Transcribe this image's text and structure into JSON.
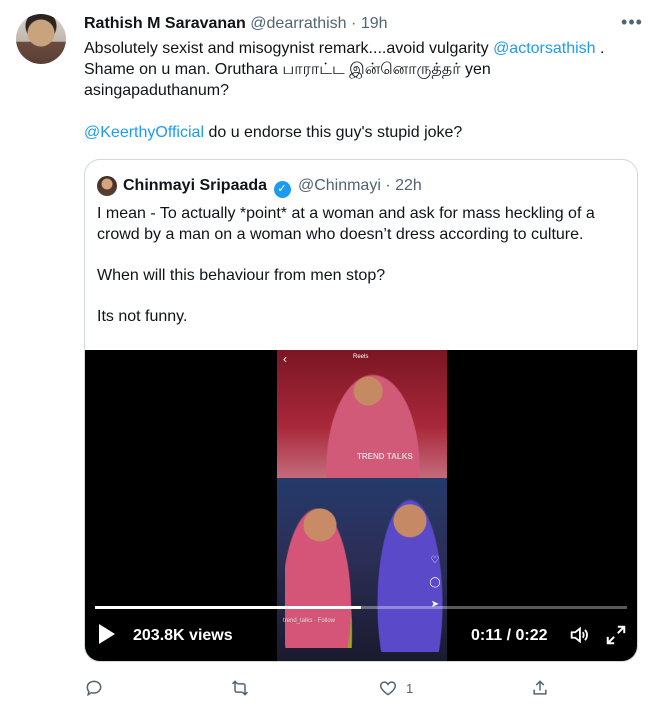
{
  "tweet": {
    "author_name": "Rathish M Saravanan",
    "author_handle": "@dearrathish",
    "separator": "·",
    "time": "19h",
    "text_line1_before": "Absolutely sexist and misogynist remark....avoid vulgarity ",
    "mention1": "@actorsathish",
    "text_line1_after": " .",
    "text_line2": "Shame on u man. Oruthara பாராட்ட இன்னொருத்தர் yen",
    "text_line3": "asingapaduthanum?",
    "mention2": "@KeerthyOfficial",
    "text_line4_after": " do u endorse this guy's stupid joke?"
  },
  "quote": {
    "author_name": "Chinmayi Sripaada",
    "author_handle": "@Chinmayi",
    "separator": "·",
    "time": "22h",
    "paragraph1": "I mean - To actually *point* at a woman and ask for mass heckling of a crowd by a man on a woman who doesn’t dress according to culture.",
    "paragraph2": "When will this behaviour from men stop?",
    "paragraph3": "Its not funny."
  },
  "video": {
    "views": "203.8K views",
    "current_time": "0:11",
    "time_separator": " / ",
    "duration": "0:22",
    "progress": 0.5,
    "overlay_reels": "Reels",
    "overlay_watermark": "TREND TALKS",
    "overlay_user": "trend_talks · Follow"
  },
  "actions": {
    "likes": "1"
  },
  "colors": {
    "link": "#1d9bf0",
    "secondary_text": "#536471",
    "border": "#cfd9de"
  }
}
